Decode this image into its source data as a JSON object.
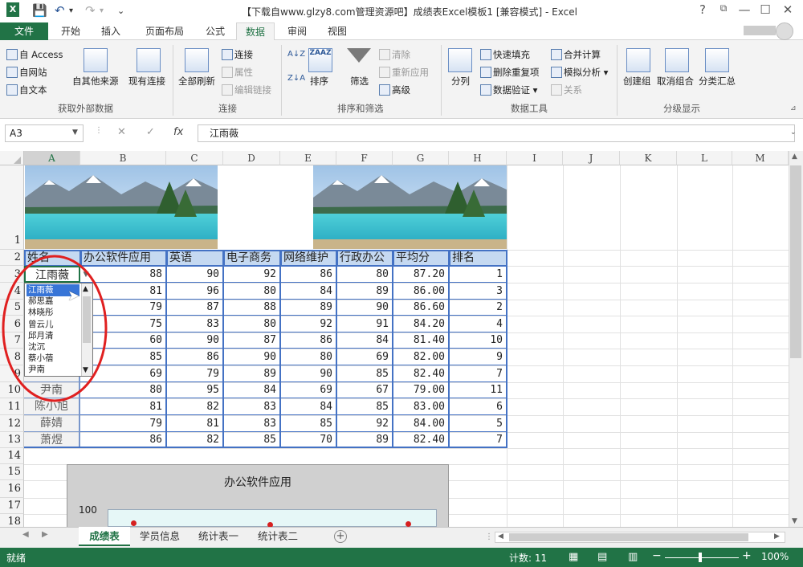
{
  "window": {
    "title": "【下载自www.glzy8.com管理资源吧】成绩表Excel模板1  [兼容模式] - Excel"
  },
  "window_controls": {
    "help": "?",
    "min": "—",
    "max": "☐",
    "close": "✕"
  },
  "ribbon_tabs": [
    "文件",
    "开始",
    "插入",
    "页面布局",
    "公式",
    "数据",
    "审阅",
    "视图"
  ],
  "ribbon": {
    "get_external": {
      "access": "自 Access",
      "web": "自网站",
      "text": "自文本",
      "other": "自其他来源",
      "existing": "现有连接",
      "label": "获取外部数据"
    },
    "connections": {
      "refresh_all": "全部刷新",
      "conn": "连接",
      "props": "属性",
      "edit_links": "编辑链接",
      "label": "连接"
    },
    "sort_filter": {
      "sort": "排序",
      "filter": "筛选",
      "clear": "清除",
      "reapply": "重新应用",
      "advanced": "高级",
      "label": "排序和筛选",
      "az": "A↓Z",
      "za": "Z↓A",
      "az_box": "ZAAZ"
    },
    "data_tools": {
      "split": "分列",
      "flash": "快速填充",
      "remove_dup": "删除重复项",
      "validate": "数据验证",
      "consolidate": "合并计算",
      "whatif": "模拟分析",
      "relations": "关系",
      "label": "数据工具"
    },
    "outline": {
      "group": "创建组",
      "ungroup": "取消组合",
      "subtotal": "分类汇总",
      "label": "分级显示"
    }
  },
  "formula_bar": {
    "name_box": "A3",
    "fx": "fx",
    "value": "江雨薇",
    "cancel": "✕",
    "enter": "✓"
  },
  "columns": [
    "A",
    "B",
    "C",
    "D",
    "E",
    "F",
    "G",
    "H",
    "I",
    "J",
    "K",
    "L",
    "M"
  ],
  "rows": [
    "1",
    "2",
    "3",
    "4",
    "5",
    "6",
    "7",
    "8",
    "9",
    "10",
    "11",
    "12",
    "13",
    "14",
    "15",
    "16",
    "17",
    "18"
  ],
  "headers": [
    "姓名",
    "办公软件应用",
    "英语",
    "电子商务",
    "网络维护",
    "行政办公",
    "平均分",
    "排名"
  ],
  "table_rows": [
    {
      "name": "江雨薇",
      "v": [
        "88",
        "90",
        "92",
        "86",
        "80",
        "87.20",
        "1"
      ]
    },
    {
      "name": "",
      "v": [
        "81",
        "96",
        "80",
        "84",
        "89",
        "86.00",
        "3"
      ]
    },
    {
      "name": "",
      "v": [
        "79",
        "87",
        "88",
        "89",
        "90",
        "86.60",
        "2"
      ]
    },
    {
      "name": "",
      "v": [
        "75",
        "83",
        "80",
        "92",
        "91",
        "84.20",
        "4"
      ]
    },
    {
      "name": "",
      "v": [
        "60",
        "90",
        "87",
        "86",
        "84",
        "81.40",
        "10"
      ]
    },
    {
      "name": "",
      "v": [
        "85",
        "86",
        "90",
        "80",
        "69",
        "82.00",
        "9"
      ]
    },
    {
      "name": "",
      "v": [
        "69",
        "79",
        "89",
        "90",
        "85",
        "82.40",
        "7"
      ]
    },
    {
      "name": "尹南",
      "v": [
        "80",
        "95",
        "84",
        "69",
        "67",
        "79.00",
        "11"
      ]
    },
    {
      "name": "陈小旭",
      "v": [
        "81",
        "82",
        "83",
        "84",
        "85",
        "83.00",
        "6"
      ]
    },
    {
      "name": "薛婧",
      "v": [
        "79",
        "81",
        "83",
        "85",
        "92",
        "84.00",
        "5"
      ]
    },
    {
      "name": "萧煜",
      "v": [
        "86",
        "82",
        "85",
        "70",
        "89",
        "82.40",
        "7"
      ]
    }
  ],
  "dropdown": {
    "items": [
      "江雨薇",
      "郝思嘉",
      "林晓彤",
      "曾云儿",
      "邱月清",
      "沈沉",
      "蔡小蓓",
      "尹南"
    ],
    "selected": "江雨薇"
  },
  "chart": {
    "title": "办公软件应用",
    "y_tick": "100"
  },
  "sheet_tabs": [
    "成绩表",
    "学员信息",
    "统计表一",
    "统计表二"
  ],
  "active_sheet": "成绩表",
  "status": {
    "ready": "就绪",
    "count": "计数: 11",
    "zoom": "100%"
  },
  "colors": {
    "excel_green": "#217346",
    "header_fill": "#c5d9f1",
    "border_blue": "#4472c4",
    "annotation": "#e02020"
  }
}
